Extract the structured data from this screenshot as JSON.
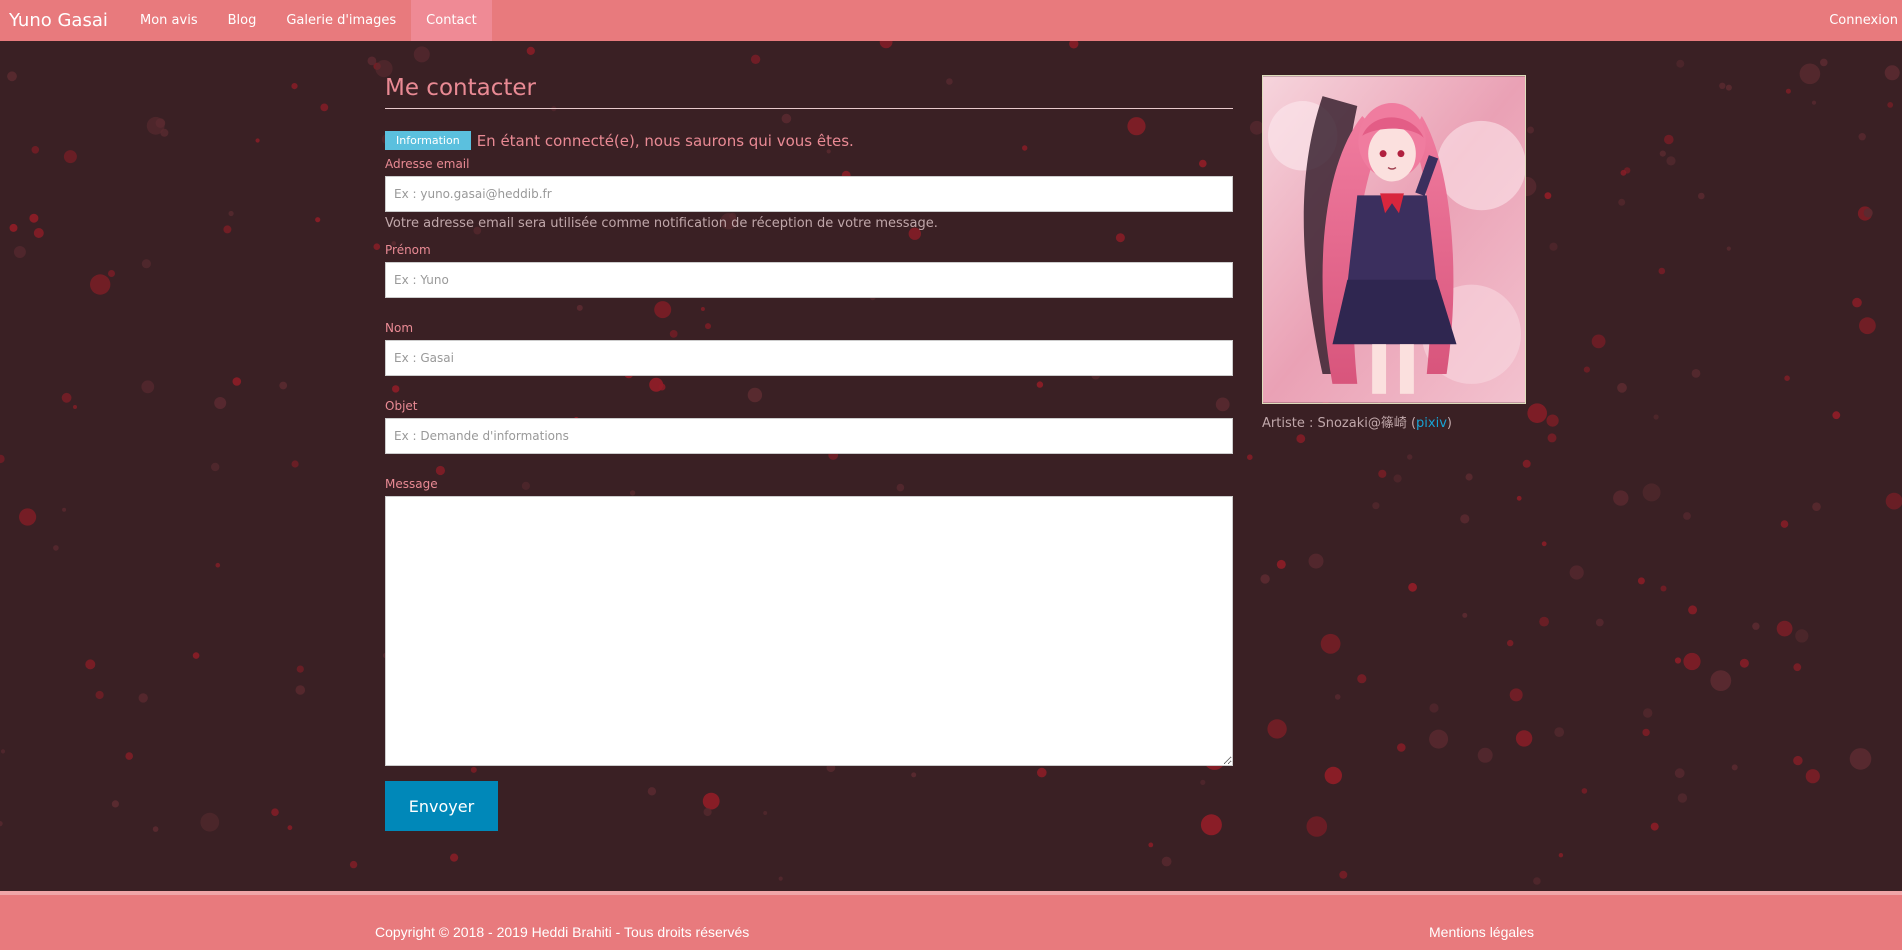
{
  "nav": {
    "brand": "Yuno Gasai",
    "links": [
      {
        "label": "Mon avis"
      },
      {
        "label": "Blog"
      },
      {
        "label": "Galerie d'images"
      },
      {
        "label": "Contact"
      }
    ],
    "active": "Contact",
    "login": "Connexion"
  },
  "form": {
    "title": "Me contacter",
    "info_badge": "Information",
    "info_text": "En étant connecté(e), nous saurons qui vous êtes.",
    "email_label": "Adresse email",
    "email_placeholder": "Ex : yuno.gasai@heddib.fr",
    "email_help": "Votre adresse email sera utilisée comme notification de réception de votre message.",
    "firstname_label": "Prénom",
    "firstname_placeholder": "Ex : Yuno",
    "lastname_label": "Nom",
    "lastname_placeholder": "Ex : Gasai",
    "subject_label": "Objet",
    "subject_placeholder": "Ex : Demande d'informations",
    "message_label": "Message",
    "submit_label": "Envoyer"
  },
  "sidebar": {
    "artist_prefix": "Artiste : Snozaki@篠崎 (",
    "artist_link": "pixiv",
    "artist_suffix": ")"
  },
  "footer": {
    "copyright": "Copyright © 2018 - 2019 Heddi Brahiti - Tous droits réservés",
    "legal": "Mentions légales"
  },
  "colors": {
    "navbar": "#e87a7d",
    "background": "#3a2024",
    "accent_text": "#e98a94",
    "info_badge": "#5bc0de",
    "submit_button": "#0088b9"
  }
}
